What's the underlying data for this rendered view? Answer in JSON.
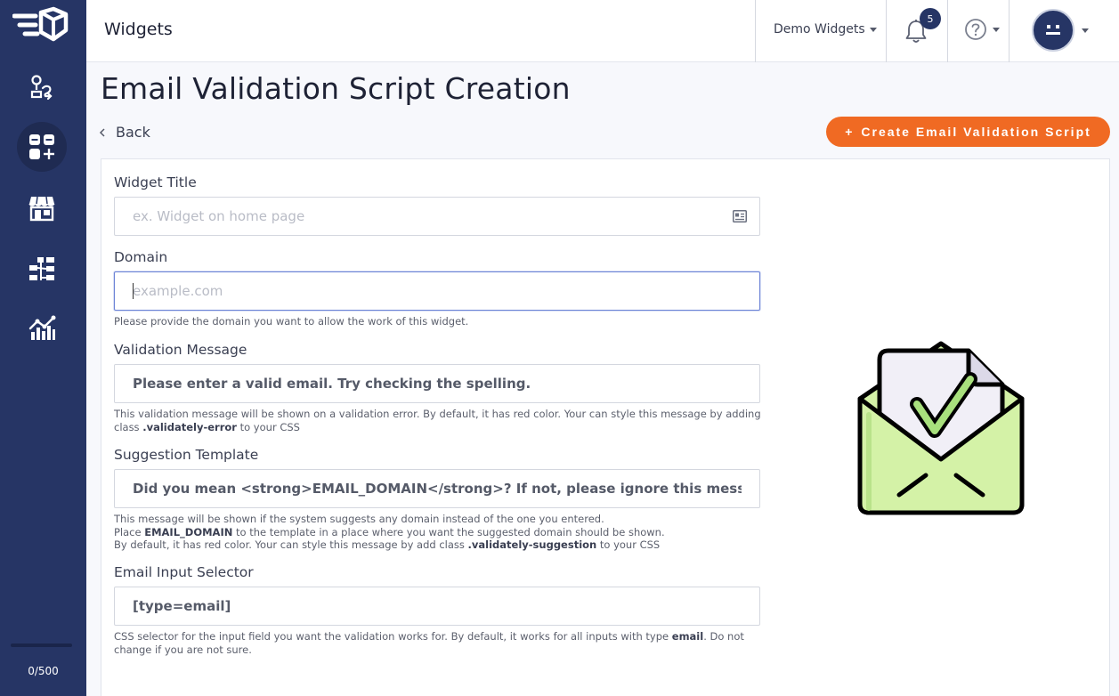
{
  "header": {
    "title": "Widgets",
    "workspace": "Demo Widgets",
    "notification_count": "5"
  },
  "sidebar": {
    "items": [
      {
        "icon": "routing-icon"
      },
      {
        "icon": "widgets-add-icon",
        "active": true
      },
      {
        "icon": "store-icon"
      },
      {
        "icon": "hierarchy-icon"
      },
      {
        "icon": "analytics-icon"
      }
    ],
    "quota": "0/500"
  },
  "page": {
    "title": "Email Validation Script Creation",
    "back_label": "Back",
    "create_button": "Create Email Validation Script",
    "create_button_icon": "+"
  },
  "form": {
    "widget_title": {
      "label": "Widget Title",
      "placeholder": "ex. Widget on home page",
      "value": ""
    },
    "domain": {
      "label": "Domain",
      "placeholder": "example.com",
      "value": "",
      "help": "Please provide the domain you want to allow the work of this widget."
    },
    "validation_message": {
      "label": "Validation Message",
      "value": "Please enter a valid email. Try checking the spelling.",
      "help_1": "This validation message will be shown on a validation error. By default, it has red color. Your can style this message by adding class",
      "help_class": ".validately-error",
      "help_2": "to your CSS"
    },
    "suggestion_template": {
      "label": "Suggestion Template",
      "value": "Did you mean <strong>EMAIL_DOMAIN</strong>? If not, please ignore this message.",
      "help_line1": "This message will be shown if the system suggests any domain instead of the one you entered.",
      "help_line2_a": "Place",
      "help_line2_token": "EMAIL_DOMAIN",
      "help_line2_b": "to the template in a place where you want the suggested domain should be shown.",
      "help_line3_a": "By default, it has red color. Your can style this message by add class",
      "help_line3_class": ".validately-suggestion",
      "help_line3_b": "to your CSS"
    },
    "email_input_selector": {
      "label": "Email Input Selector",
      "value": "[type=email]",
      "help_a": "CSS selector for the input field you want the validation works for. By default, it works for all inputs with type",
      "help_token": "email",
      "help_b": ". Do not change if you are not sure."
    }
  },
  "colors": {
    "sidebar": "#263565",
    "accent": "#f06a23",
    "illustration_green": "#d4f2a7",
    "illustration_check": "#a8e07d"
  }
}
